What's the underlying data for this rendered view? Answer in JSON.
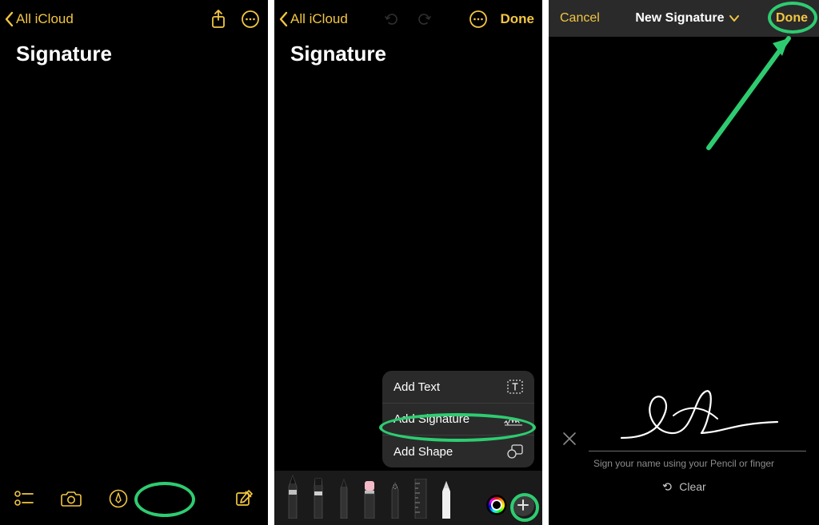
{
  "panel1": {
    "back_label": "All iCloud",
    "title": "Signature"
  },
  "panel2": {
    "back_label": "All iCloud",
    "title": "Signature",
    "done_label": "Done",
    "menu": {
      "add_text": "Add Text",
      "add_signature": "Add Signature",
      "add_shape": "Add Shape"
    }
  },
  "panel3": {
    "cancel_label": "Cancel",
    "title": "New Signature",
    "done_label": "Done",
    "hint": "Sign your name using your Pencil or finger",
    "clear_label": "Clear"
  },
  "colors": {
    "accent": "#f2c642",
    "highlight": "#2ecc71"
  }
}
